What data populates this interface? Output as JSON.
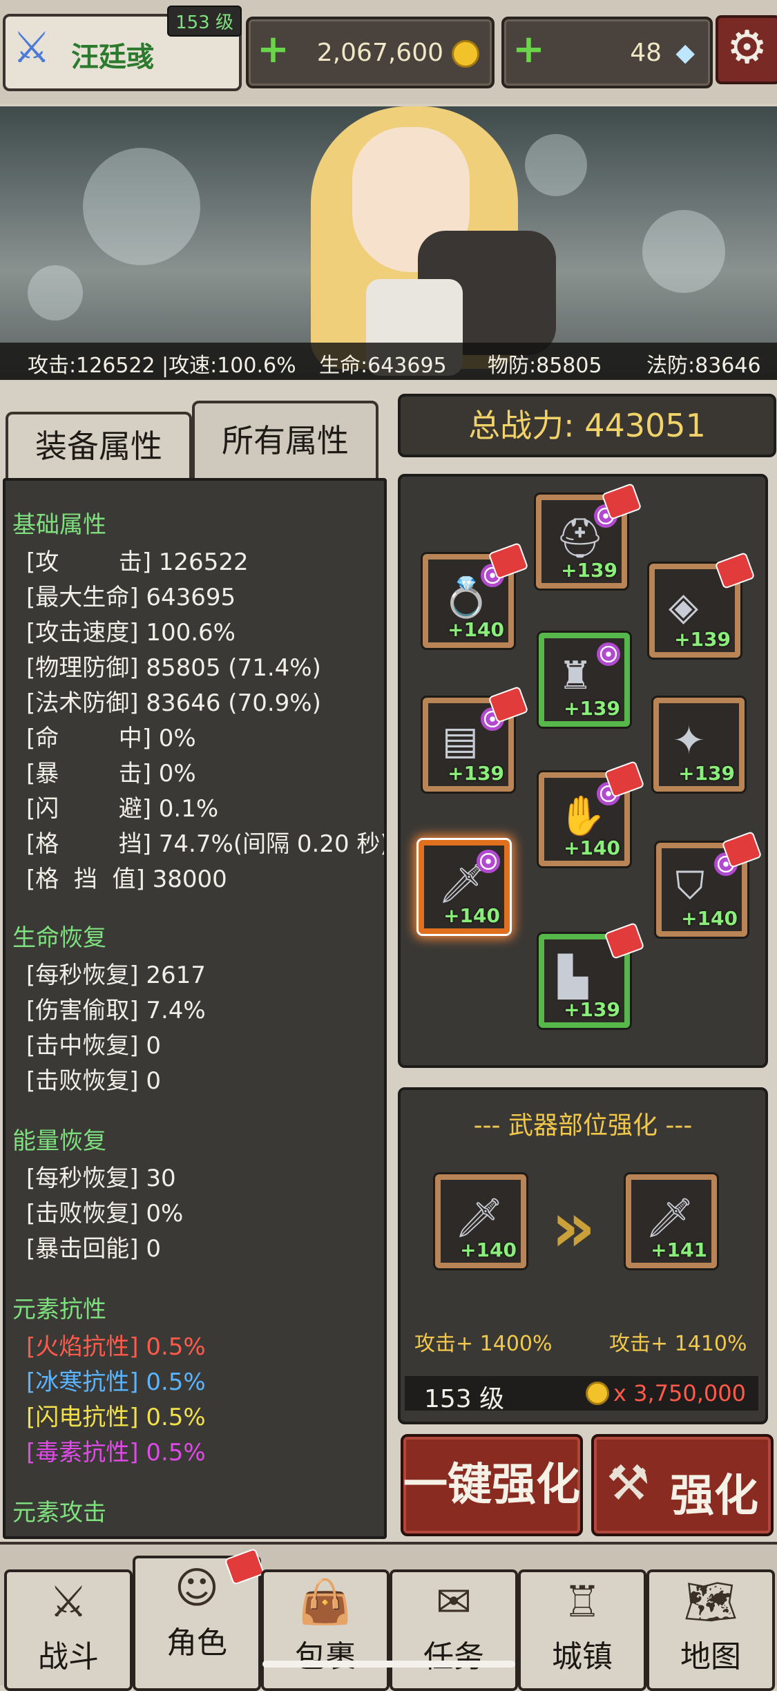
{
  "header": {
    "player_name": "汪廷彧",
    "level_badge": "153 级",
    "gold": "2,067,600",
    "gems": "48",
    "plus_symbol": "+",
    "settings_icon": "gear-icon"
  },
  "hero_stats": {
    "attack": "攻击:126522",
    "attack_speed": "|攻速:100.6%",
    "hp": "生命:643695",
    "phys_def": "物防:85805",
    "mag_def": "法防:83646"
  },
  "tabs": {
    "equipment": "装备属性",
    "all": "所有属性"
  },
  "total_power": "总战力: 443051",
  "attributes": {
    "basic_title": "基础属性",
    "basic": [
      "[攻        击] 126522",
      "[最大生命] 643695",
      "[攻击速度] 100.6%",
      "[物理防御] 85805 (71.4%)",
      "[法术防御] 83646 (70.9%)",
      "[命        中] 0%",
      "[暴        击] 0%",
      "[闪        避] 0.1%",
      "[格        挡] 74.7%(间隔 0.20 秒)",
      "[格  挡  值] 38000"
    ],
    "life_title": "生命恢复",
    "life": [
      "[每秒恢复] 2617",
      "[伤害偷取] 7.4%",
      "[击中恢复] 0",
      "[击败恢复] 0"
    ],
    "energy_title": "能量恢复",
    "energy": [
      "[每秒恢复] 30",
      "[击败恢复] 0%",
      "[暴击回能] 0"
    ],
    "resist_title": "元素抗性",
    "resist": [
      {
        "label": "[火焰抗性]",
        "value": " 0.5%",
        "color": "#ff5a4a"
      },
      {
        "label": "[冰寒抗性]",
        "value": " 0.5%",
        "color": "#5ab4ff"
      },
      {
        "label": "[闪电抗性]",
        "value": " 0.5%",
        "color": "#f2e14a"
      },
      {
        "label": "[毒素抗性]",
        "value": " 0.5%",
        "color": "#e04ae8"
      }
    ],
    "element_attack_title": "元素攻击"
  },
  "equipment": [
    {
      "slot": "helmet",
      "level": "+139",
      "icon": "helmet-icon",
      "frame": "orange"
    },
    {
      "slot": "ring",
      "level": "+140",
      "icon": "ring-icon",
      "frame": "orange"
    },
    {
      "slot": "necklace",
      "level": "+139",
      "icon": "necklace-icon",
      "frame": "orange"
    },
    {
      "slot": "armor",
      "level": "+139",
      "icon": "armor-icon",
      "frame": "green"
    },
    {
      "slot": "belt",
      "level": "+139",
      "icon": "belt-icon",
      "frame": "orange"
    },
    {
      "slot": "shoulder",
      "level": "+139",
      "icon": "shoulder-icon",
      "frame": "orange"
    },
    {
      "slot": "gloves",
      "level": "+140",
      "icon": "gloves-icon",
      "frame": "orange"
    },
    {
      "slot": "weapon",
      "level": "+140",
      "icon": "weapon-icon",
      "frame": "orange-selected"
    },
    {
      "slot": "shield",
      "level": "+140",
      "icon": "shield-icon",
      "frame": "orange"
    },
    {
      "slot": "boots",
      "level": "+139",
      "icon": "boots-icon",
      "frame": "green"
    }
  ],
  "upgrade": {
    "title": "--- 武器部位强化 ---",
    "from_level": "+140",
    "to_level": "+141",
    "from_stat": "攻击+ 1400%",
    "to_stat": "攻击+ 1410%",
    "req_level": "153 级",
    "cost": "x 3,750,000"
  },
  "buttons": {
    "auto_upgrade": "一键强化",
    "upgrade": "强化"
  },
  "nav": [
    "战斗",
    "角色",
    "包裹",
    "任务",
    "城镇",
    "地图"
  ]
}
